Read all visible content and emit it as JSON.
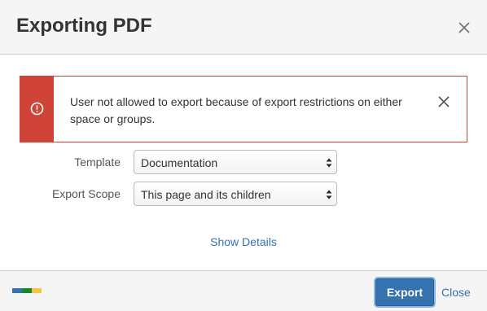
{
  "dialog": {
    "title": "Exporting PDF"
  },
  "alert": {
    "type": "error",
    "color": "#d04437",
    "message": "User not allowed to export because of export restrictions on either space or groups.",
    "icon": "error-circle-icon"
  },
  "form": {
    "template": {
      "label": "Template",
      "value": "Documentation"
    },
    "scope": {
      "label": "Export Scope",
      "value": "This page and its children"
    }
  },
  "details": {
    "link_label": "Show Details"
  },
  "footer": {
    "export_label": "Export",
    "close_label": "Close",
    "logo_colors": [
      "#3572b0",
      "#14892c",
      "#f6c342"
    ]
  },
  "colors": {
    "accent": "#3572b0",
    "error": "#d04437",
    "header_bg": "#f5f5f5"
  }
}
